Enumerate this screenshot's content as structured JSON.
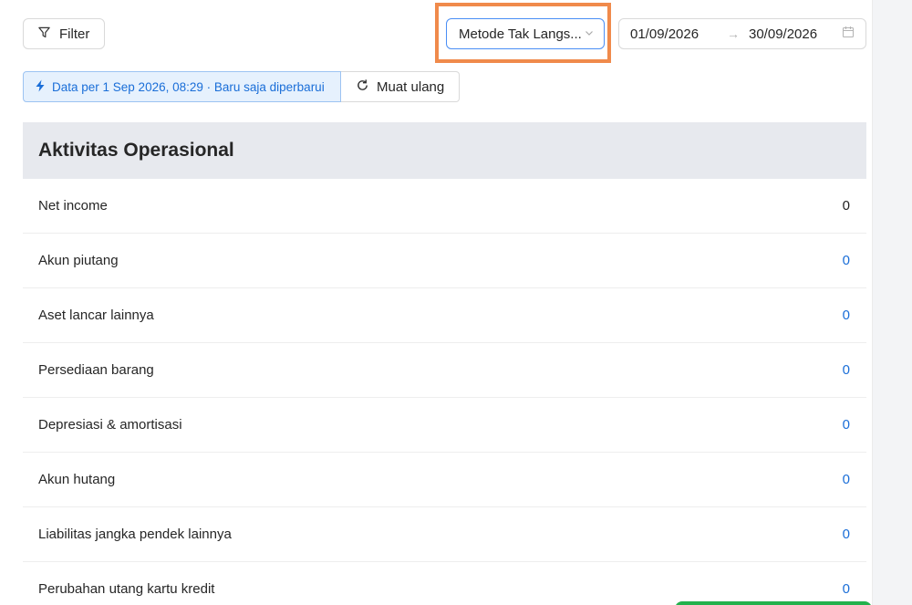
{
  "toolbar": {
    "filter_label": "Filter",
    "method_select_value": "Metode Tak Langs...",
    "date_start": "01/09/2026",
    "date_arrow": "→",
    "date_end": "30/09/2026"
  },
  "status": {
    "info_text": "Data per 1 Sep 2026, 08:29 · Baru saja diperbarui",
    "reload_label": "Muat ulang"
  },
  "section": {
    "title": "Aktivitas Operasional",
    "rows": [
      {
        "label": "Net income",
        "value": "0"
      },
      {
        "label": "Akun piutang",
        "value": "0"
      },
      {
        "label": "Aset lancar lainnya",
        "value": "0"
      },
      {
        "label": "Persediaan barang",
        "value": "0"
      },
      {
        "label": "Depresiasi & amortisasi",
        "value": "0"
      },
      {
        "label": "Akun hutang",
        "value": "0"
      },
      {
        "label": "Liabilitas jangka pendek lainnya",
        "value": "0"
      },
      {
        "label": "Perubahan utang kartu kredit",
        "value": "0"
      }
    ]
  },
  "colors": {
    "accent_blue": "#1a6ed8",
    "highlight_orange": "#f08a4b",
    "header_bg": "#e7e9ee",
    "info_bg": "#e6f1fd"
  },
  "icons": {
    "filter": "filter-icon",
    "chevron": "chevron-down-icon",
    "calendar": "calendar-icon",
    "bolt": "lightning-icon",
    "reload": "reload-icon"
  }
}
